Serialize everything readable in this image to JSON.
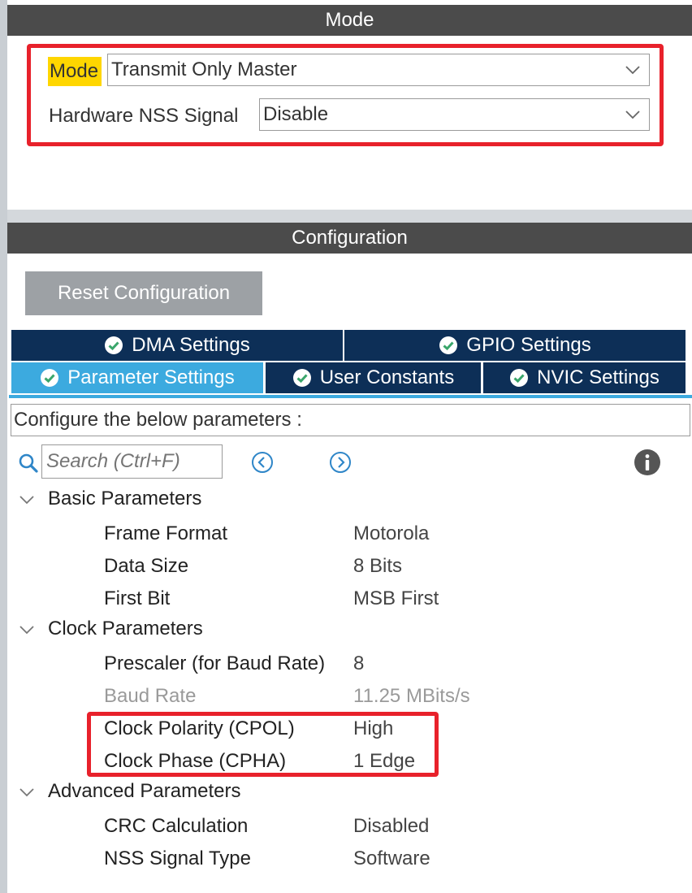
{
  "mode_section": {
    "header": "Mode",
    "mode_label": "Mode",
    "mode_value": "Transmit Only Master",
    "nss_label": "Hardware NSS Signal",
    "nss_value": "Disable"
  },
  "config_section": {
    "header": "Configuration",
    "reset_button": "Reset Configuration",
    "tabs": [
      {
        "label": "DMA Settings"
      },
      {
        "label": "GPIO Settings"
      },
      {
        "label": "Parameter Settings",
        "active": true
      },
      {
        "label": "User Constants"
      },
      {
        "label": "NVIC Settings"
      }
    ],
    "description": "Configure the below parameters :",
    "search_placeholder": "Search (Ctrl+F)"
  },
  "groups": [
    {
      "title": "Basic Parameters",
      "params": [
        {
          "name": "Frame Format",
          "value": "Motorola"
        },
        {
          "name": "Data Size",
          "value": "8 Bits"
        },
        {
          "name": "First Bit",
          "value": "MSB First"
        }
      ]
    },
    {
      "title": "Clock Parameters",
      "params": [
        {
          "name": "Prescaler (for Baud Rate)",
          "value": "8"
        },
        {
          "name": "Baud Rate",
          "value": "11.25 MBits/s",
          "disabled": true
        },
        {
          "name": "Clock Polarity (CPOL)",
          "value": "High"
        },
        {
          "name": "Clock Phase (CPHA)",
          "value": "1 Edge"
        }
      ]
    },
    {
      "title": "Advanced Parameters",
      "params": [
        {
          "name": "CRC Calculation",
          "value": "Disabled"
        },
        {
          "name": "NSS Signal Type",
          "value": "Software"
        }
      ]
    }
  ],
  "colors": {
    "header_bg": "#4b4b4b",
    "tab_dark": "#0d2f57",
    "tab_active": "#3caadf",
    "highlight_red": "#e8212b",
    "mode_label_highlight": "#ffd600"
  }
}
